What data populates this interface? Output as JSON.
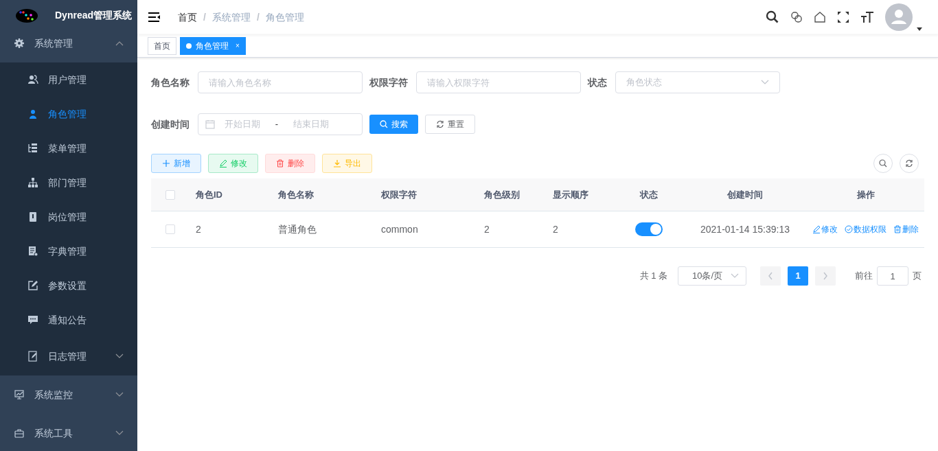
{
  "sidebar": {
    "title": "Dynread管理系统",
    "menu": [
      {
        "label": "系统管理",
        "kind": "submenu",
        "expanded": true,
        "children": [
          {
            "label": "用户管理",
            "kind": "item",
            "selected": false
          },
          {
            "label": "角色管理",
            "kind": "item",
            "selected": true
          },
          {
            "label": "菜单管理",
            "kind": "item",
            "selected": false
          },
          {
            "label": "部门管理",
            "kind": "item",
            "selected": false
          },
          {
            "label": "岗位管理",
            "kind": "item",
            "selected": false
          },
          {
            "label": "字典管理",
            "kind": "item",
            "selected": false
          },
          {
            "label": "参数设置",
            "kind": "item",
            "selected": false
          },
          {
            "label": "通知公告",
            "kind": "item",
            "selected": false
          },
          {
            "label": "日志管理",
            "kind": "submenu",
            "expanded": false,
            "selected": false
          }
        ]
      },
      {
        "label": "系统监控",
        "kind": "submenu",
        "expanded": false
      },
      {
        "label": "系统工具",
        "kind": "submenu",
        "expanded": false
      }
    ]
  },
  "breadcrumb": {
    "separator": "/",
    "items": [
      "首页",
      "系统管理",
      "角色管理"
    ]
  },
  "tabs": [
    {
      "label": "首页",
      "selected": false
    },
    {
      "label": "角色管理",
      "selected": true,
      "closable": true,
      "close": "×"
    }
  ],
  "filters": [
    {
      "label": "角色名称",
      "kind": "input",
      "placeholder": "请输入角色名称"
    },
    {
      "label": "权限字符",
      "kind": "input",
      "placeholder": "请输入权限字符"
    },
    {
      "label": "状态",
      "kind": "select",
      "placeholder": "角色状态"
    },
    {
      "label": "创建时间",
      "kind": "daterange",
      "start_placeholder": "开始日期",
      "separator": "-",
      "end_placeholder": "结束日期"
    }
  ],
  "search_buttons": [
    "搜索",
    "重置"
  ],
  "toolbar": [
    {
      "label": "新增",
      "kind": "add"
    },
    {
      "label": "修改",
      "kind": "edit"
    },
    {
      "label": "删除",
      "kind": "delete"
    },
    {
      "label": "导出",
      "kind": "export"
    }
  ],
  "table": {
    "columns": [
      "角色ID",
      "角色名称",
      "权限字符",
      "角色级别",
      "显示顺序",
      "状态",
      "创建时间",
      "操作"
    ],
    "header_checked": false,
    "rows": [
      {
        "checked": false,
        "id": "2",
        "name": "普通角色",
        "key": "common",
        "level": "2",
        "sort": "2",
        "on": true,
        "created": "2021-01-14 15:39:13",
        "actions": [
          "修改",
          "数据权限",
          "删除"
        ]
      }
    ]
  },
  "pagination": {
    "total": "共 1 条",
    "page_size": "10条/页",
    "pages": [
      {
        "label": "1",
        "selected": true
      }
    ],
    "goto_label": "前往",
    "goto_value": "1",
    "goto_suffix": "页"
  }
}
